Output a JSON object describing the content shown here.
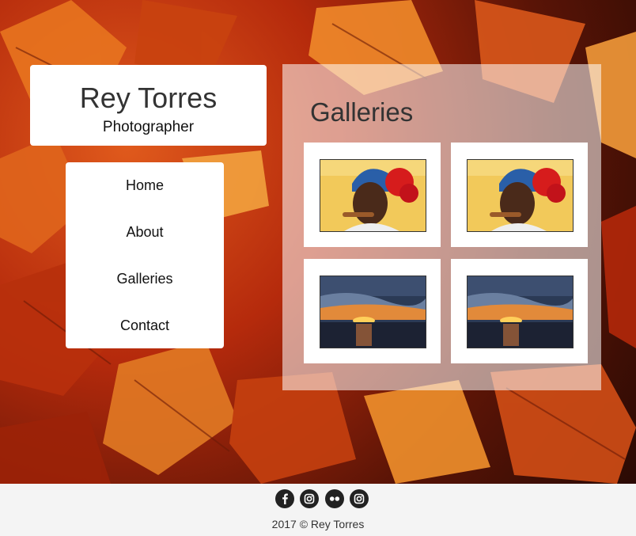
{
  "header": {
    "title": "Rey Torres",
    "subtitle": "Photographer"
  },
  "nav": {
    "items": [
      {
        "label": "Home"
      },
      {
        "label": "About"
      },
      {
        "label": "Galleries"
      },
      {
        "label": "Contact"
      }
    ]
  },
  "gallery": {
    "heading": "Galleries",
    "thumbnails": [
      {
        "subject": "portrait-woman-with-cigar"
      },
      {
        "subject": "portrait-woman-with-cigar"
      },
      {
        "subject": "sunset-over-water"
      },
      {
        "subject": "sunset-over-water"
      }
    ]
  },
  "footer": {
    "social_icons": [
      "facebook-icon",
      "instagram-icon",
      "flickr-icon",
      "instagram-icon"
    ],
    "copyright": "2017 © Rey Torres"
  }
}
